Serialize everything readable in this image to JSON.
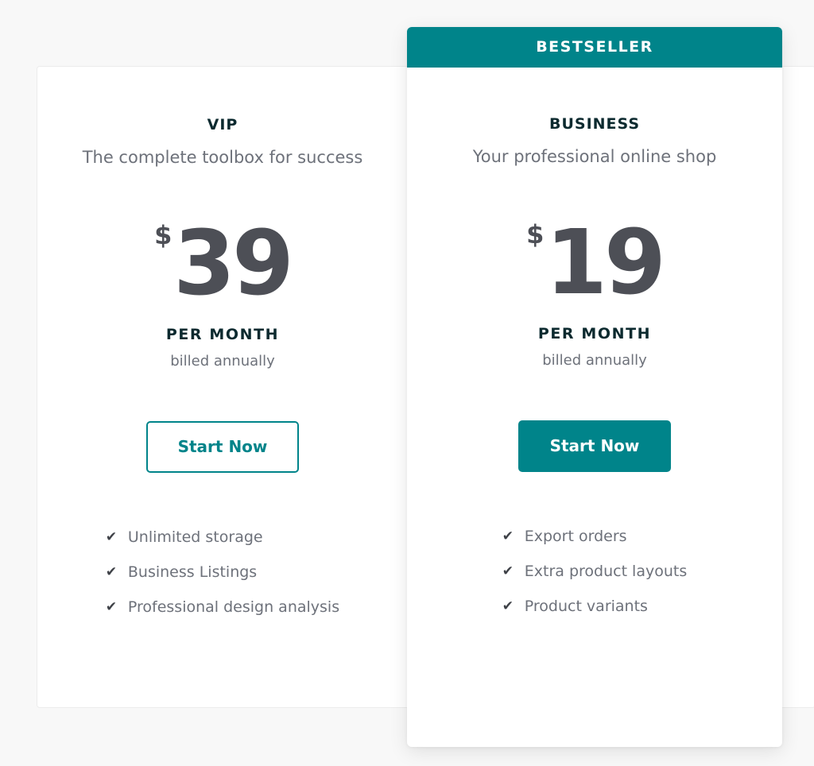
{
  "plans": {
    "vip": {
      "name": "VIP",
      "description": "The complete toolbox for success",
      "currency": "$",
      "price": "39",
      "period": "PER MONTH",
      "billing": "billed annually",
      "cta_label": "Start Now",
      "features": [
        "Unlimited storage",
        "Business Listings",
        "Professional design analysis"
      ]
    },
    "business": {
      "badge": "BESTSELLER",
      "name": "BUSINESS",
      "description": "Your professional online shop",
      "currency": "$",
      "price": "19",
      "period": "PER MONTH",
      "billing": "billed annually",
      "cta_label": "Start Now",
      "features": [
        "Export orders",
        "Extra product layouts",
        "Product variants"
      ]
    }
  },
  "colors": {
    "accent": "#00848a",
    "heading": "#0c2a2f",
    "price": "#4d4f56",
    "muted": "#6d717a"
  },
  "icons": {
    "feature_check": "check-icon"
  }
}
